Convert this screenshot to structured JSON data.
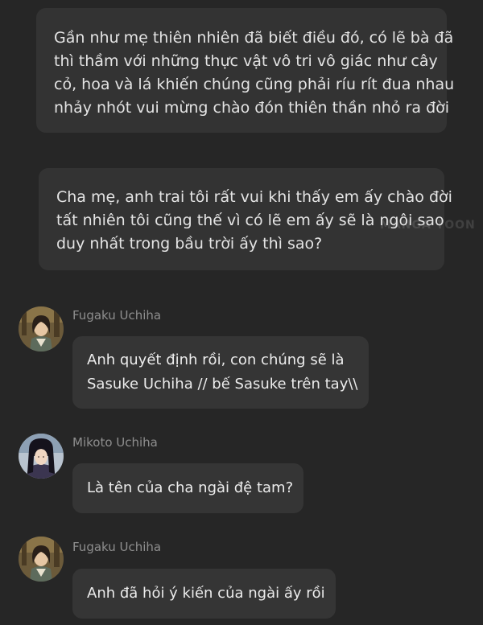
{
  "narration_1": {
    "lines": [
      "Gần như mẹ thiên nhiên đã biết điều đó, có lẽ bà đã",
      "thì thầm với những thực vật vô tri vô giác như cây",
      "cỏ, hoa và lá khiến chúng cũng phải ríu rít đua nhau",
      "nhảy nhót vui mừng chào đón thiên thần nhỏ ra đời"
    ]
  },
  "narration_2": {
    "lines": [
      "Cha mẹ, anh trai tôi rất vui khi thấy em ấy chào đời",
      "tất nhiên tôi cũng thế vì có lẽ em ấy sẽ là ngôi sao",
      "duy nhất trong bầu trời ấy thì sao?"
    ]
  },
  "watermark": "MANGA TOON",
  "messages": [
    {
      "sender": "Fugaku Uchiha",
      "avatar_icon": "fugaku-avatar",
      "lines": [
        "Anh quyết định rồi, con chúng sẽ là",
        "Sasuke Uchiha // bế Sasuke trên tay\\\\"
      ]
    },
    {
      "sender": "Mikoto Uchiha",
      "avatar_icon": "mikoto-avatar",
      "lines": [
        "Là tên của cha ngài đệ tam?"
      ]
    },
    {
      "sender": "Fugaku Uchiha",
      "avatar_icon": "fugaku-avatar",
      "lines": [
        "Anh đã hỏi ý kiến của ngài ấy rồi"
      ]
    }
  ],
  "colors": {
    "background": "#262626",
    "bubble": "#353535",
    "sender_text": "#8e8e8e"
  }
}
